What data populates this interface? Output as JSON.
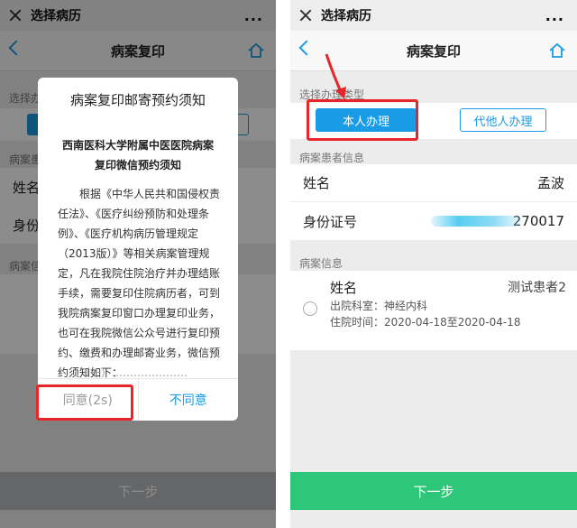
{
  "left": {
    "wx_title": "选择病历",
    "more": "...",
    "nav_title": "病案复印",
    "section1": "选择办",
    "section2": "病案患",
    "section3": "病案信",
    "row1_label": "姓名",
    "row2_label": "身份证",
    "next_label": "下一步",
    "modal": {
      "title": "病案复印邮寄预约须知",
      "subtitle": "西南医科大学附属中医医院病案复印微信预约须知",
      "body": "根据《中华人民共和国侵权责任法》、《医疗纠纷预防和处理条例》、《医疗机构病历管理规定（2013版）》等相关病案管理规定，凡在我院住院治疗并办理结账手续，需要复印住院病历者，可到我院病案复印窗口办理复印业务，也可在我院微信公众号进行复印预约、缴费和办理邮寄业务，微信预约须知如下：",
      "agree_label": "同意(2s)",
      "disagree_label": "不同意"
    }
  },
  "right": {
    "wx_title": "选择病历",
    "more": "...",
    "nav_title": "病案复印",
    "section_type_label": "选择办理类型",
    "self_button": "本人办理",
    "other_button": "代他人办理",
    "patient_info_label": "病案患者信息",
    "name_label": "姓名",
    "name_value": "孟波",
    "id_label": "身份证号",
    "id_value_suffix": "270017",
    "record_info_label": "病案信息",
    "record": {
      "name_label": "姓名",
      "name_value": "测试患者2",
      "dept": "出院科室：神经内科",
      "time": "住院时间：2020-04-18至2020-04-18"
    },
    "next_label": "下一步"
  },
  "colors": {
    "accent": "#1a9be6",
    "highlight": "#e8262a",
    "next_enabled": "#2ec77a",
    "next_disabled": "#b9bbbc"
  }
}
